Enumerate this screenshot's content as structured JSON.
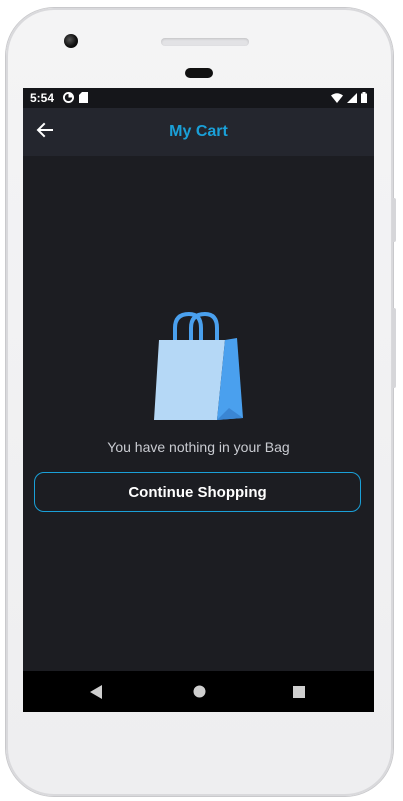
{
  "status_bar": {
    "time": "5:54",
    "left_icons": [
      "data-saver-icon",
      "sd-card-icon"
    ],
    "right_icons": [
      "wifi-icon",
      "signal-icon",
      "battery-icon"
    ]
  },
  "app_bar": {
    "title": "My Cart",
    "back_icon": "arrow-left-icon"
  },
  "empty_state": {
    "illustration": "shopping-bag-icon",
    "message": "You have nothing in your Bag",
    "button_label": "Continue Shopping"
  },
  "nav_bar": {
    "icons": [
      "nav-back-icon",
      "nav-home-icon",
      "nav-recents-icon"
    ]
  },
  "colors": {
    "accent": "#1aa0d8",
    "background": "#1c1d22",
    "app_bar": "#24262e",
    "bag_light": "#b5d8f6",
    "bag_dark": "#4aa0ee"
  }
}
